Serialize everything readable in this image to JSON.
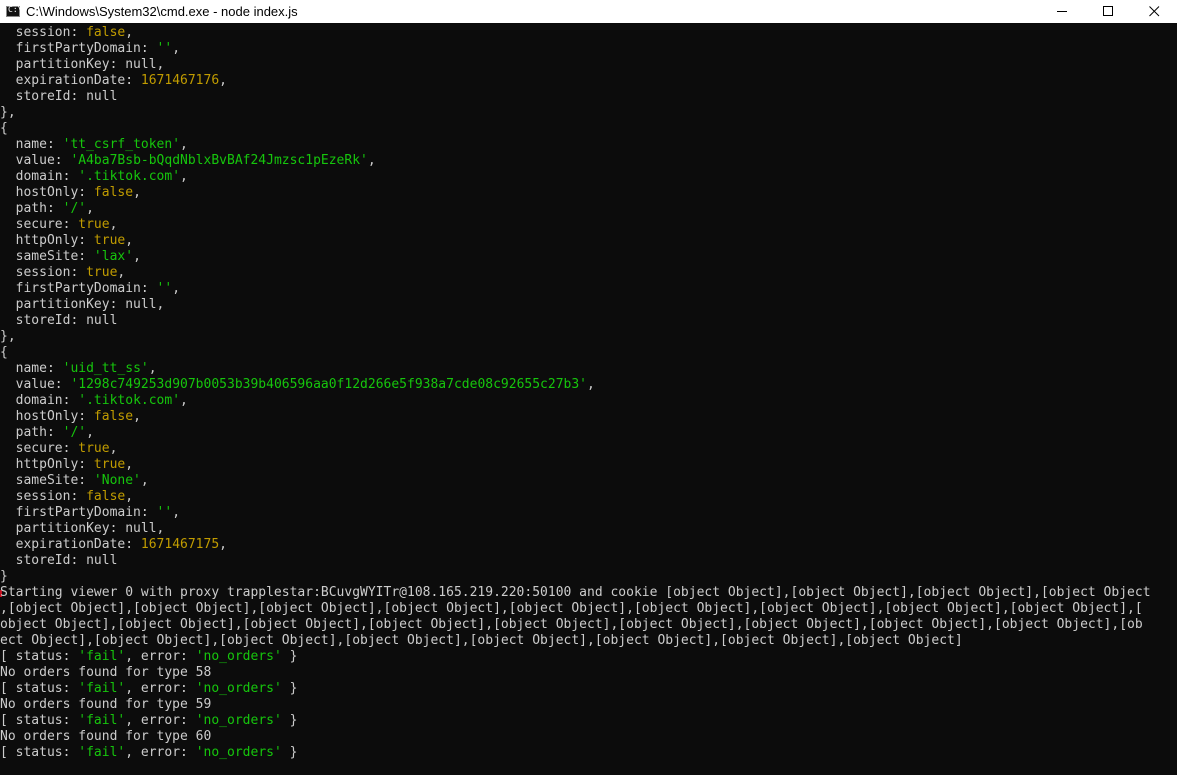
{
  "window": {
    "title": "C:\\Windows\\System32\\cmd.exe - node  index.js",
    "icon": "C:\\",
    "controls": [
      "minimize-icon",
      "maximize-icon",
      "close-icon"
    ]
  },
  "colors": {
    "background": "#0c0c0c",
    "text": "#cccccc",
    "string": "#16c60c",
    "number": "#c19c00",
    "boolean": "#c19c00"
  },
  "console": {
    "lines": [
      [
        [
          "  session: "
        ],
        [
          "false",
          "b"
        ],
        [
          ","
        ]
      ],
      [
        [
          "  firstPartyDomain: "
        ],
        [
          "''",
          "s"
        ],
        [
          ","
        ]
      ],
      [
        [
          "  partitionKey: null,"
        ]
      ],
      [
        [
          "  expirationDate: "
        ],
        [
          "1671467176",
          "n"
        ],
        [
          ","
        ]
      ],
      [
        [
          "  storeId: null"
        ]
      ],
      [
        [
          "},"
        ]
      ],
      [
        [
          "{"
        ]
      ],
      [
        [
          "  name: "
        ],
        [
          "'tt_csrf_token'",
          "s"
        ],
        [
          ","
        ]
      ],
      [
        [
          "  value: "
        ],
        [
          "'A4ba7Bsb-bQqdNblxBvBAf24Jmzsc1pEzeRk'",
          "s"
        ],
        [
          ","
        ]
      ],
      [
        [
          "  domain: "
        ],
        [
          "'.tiktok.com'",
          "s"
        ],
        [
          ","
        ]
      ],
      [
        [
          "  hostOnly: "
        ],
        [
          "false",
          "b"
        ],
        [
          ","
        ]
      ],
      [
        [
          "  path: "
        ],
        [
          "'/'",
          "s"
        ],
        [
          ","
        ]
      ],
      [
        [
          "  secure: "
        ],
        [
          "true",
          "b"
        ],
        [
          ","
        ]
      ],
      [
        [
          "  httpOnly: "
        ],
        [
          "true",
          "b"
        ],
        [
          ","
        ]
      ],
      [
        [
          "  sameSite: "
        ],
        [
          "'lax'",
          "s"
        ],
        [
          ","
        ]
      ],
      [
        [
          "  session: "
        ],
        [
          "true",
          "b"
        ],
        [
          ","
        ]
      ],
      [
        [
          "  firstPartyDomain: "
        ],
        [
          "''",
          "s"
        ],
        [
          ","
        ]
      ],
      [
        [
          "  partitionKey: null,"
        ]
      ],
      [
        [
          "  storeId: null"
        ]
      ],
      [
        [
          "},"
        ]
      ],
      [
        [
          "{"
        ]
      ],
      [
        [
          "  name: "
        ],
        [
          "'uid_tt_ss'",
          "s"
        ],
        [
          ","
        ]
      ],
      [
        [
          "  value: "
        ],
        [
          "'1298c749253d907b0053b39b406596aa0f12d266e5f938a7cde08c92655c27b3'",
          "s"
        ],
        [
          ","
        ]
      ],
      [
        [
          "  domain: "
        ],
        [
          "'.tiktok.com'",
          "s"
        ],
        [
          ","
        ]
      ],
      [
        [
          "  hostOnly: "
        ],
        [
          "false",
          "b"
        ],
        [
          ","
        ]
      ],
      [
        [
          "  path: "
        ],
        [
          "'/'",
          "s"
        ],
        [
          ","
        ]
      ],
      [
        [
          "  secure: "
        ],
        [
          "true",
          "b"
        ],
        [
          ","
        ]
      ],
      [
        [
          "  httpOnly: "
        ],
        [
          "true",
          "b"
        ],
        [
          ","
        ]
      ],
      [
        [
          "  sameSite: "
        ],
        [
          "'None'",
          "s"
        ],
        [
          ","
        ]
      ],
      [
        [
          "  session: "
        ],
        [
          "false",
          "b"
        ],
        [
          ","
        ]
      ],
      [
        [
          "  firstPartyDomain: "
        ],
        [
          "''",
          "s"
        ],
        [
          ","
        ]
      ],
      [
        [
          "  partitionKey: null,"
        ]
      ],
      [
        [
          "  expirationDate: "
        ],
        [
          "1671467175",
          "n"
        ],
        [
          ","
        ]
      ],
      [
        [
          "  storeId: null"
        ]
      ],
      [
        [
          "}"
        ]
      ],
      [
        [
          "Starting viewer 0 with proxy trapplestar:BCuvgWYITr@108.165.219.220:50100 and cookie [object Object],[object Object],[object Object],[object Object"
        ]
      ],
      [
        [
          ",[object Object],[object Object],[object Object],[object Object],[object Object],[object Object],[object Object],[object Object],[object Object],["
        ]
      ],
      [
        [
          "object Object],[object Object],[object Object],[object Object],[object Object],[object Object],[object Object],[object Object],[object Object],[ob"
        ]
      ],
      [
        [
          "ect Object],[object Object],[object Object],[object Object],[object Object],[object Object],[object Object],[object Object]"
        ]
      ],
      [
        [
          "[ status: "
        ],
        [
          "'fail'",
          "s"
        ],
        [
          ", error: "
        ],
        [
          "'no_orders'",
          "s"
        ],
        [
          " }"
        ]
      ],
      [
        [
          "No orders found for type 58"
        ]
      ],
      [
        [
          "[ status: "
        ],
        [
          "'fail'",
          "s"
        ],
        [
          ", error: "
        ],
        [
          "'no_orders'",
          "s"
        ],
        [
          " }"
        ]
      ],
      [
        [
          "No orders found for type 59"
        ]
      ],
      [
        [
          "[ status: "
        ],
        [
          "'fail'",
          "s"
        ],
        [
          ", error: "
        ],
        [
          "'no_orders'",
          "s"
        ],
        [
          " }"
        ]
      ],
      [
        [
          "No orders found for type 60"
        ]
      ],
      [
        [
          "[ status: "
        ],
        [
          "'fail'",
          "s"
        ],
        [
          ", error: "
        ],
        [
          "'no_orders'",
          "s"
        ],
        [
          " }"
        ]
      ]
    ]
  }
}
